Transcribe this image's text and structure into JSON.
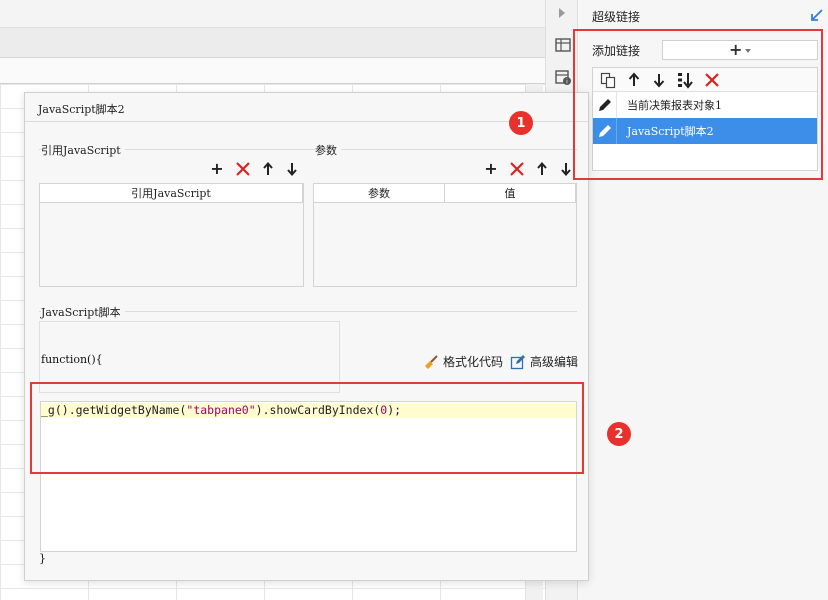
{
  "right_panel": {
    "title": "超级链接",
    "add_link_label": "添加链接",
    "add_button_glyph": "+",
    "toolbar_icons": [
      "copy-icon",
      "arrow-up-icon",
      "arrow-down-icon",
      "sort-icon",
      "delete-icon"
    ],
    "items": [
      {
        "label": "当前决策报表对象1",
        "icon": "pencil-icon",
        "selected": false
      },
      {
        "label": "JavaScript脚本2",
        "icon": "pencil-icon",
        "selected": true
      }
    ]
  },
  "dialog": {
    "title": "JavaScript脚本2",
    "ref_group": {
      "label": "引用JavaScript",
      "column": "引用JavaScript"
    },
    "params_group": {
      "label": "参数",
      "columns": [
        "参数",
        "值"
      ]
    },
    "script_group": {
      "label": "JavaScript脚本",
      "fn_open": "function(){",
      "fn_close": "}",
      "format_label": "格式化代码",
      "advanced_label": "高级编辑",
      "code": {
        "prefix": "_g().getWidgetByName(",
        "string": "\"tabpane0\"",
        "middle": ").showCardByIndex(",
        "number": "0",
        "suffix": ");"
      }
    }
  },
  "annotations": {
    "badge1": "1",
    "badge2": "2"
  },
  "colors": {
    "accent": "#3d8ee8",
    "annotation_red": "#e3393c",
    "delete_red": "#e02020",
    "code_highlight": "#fffccf"
  }
}
